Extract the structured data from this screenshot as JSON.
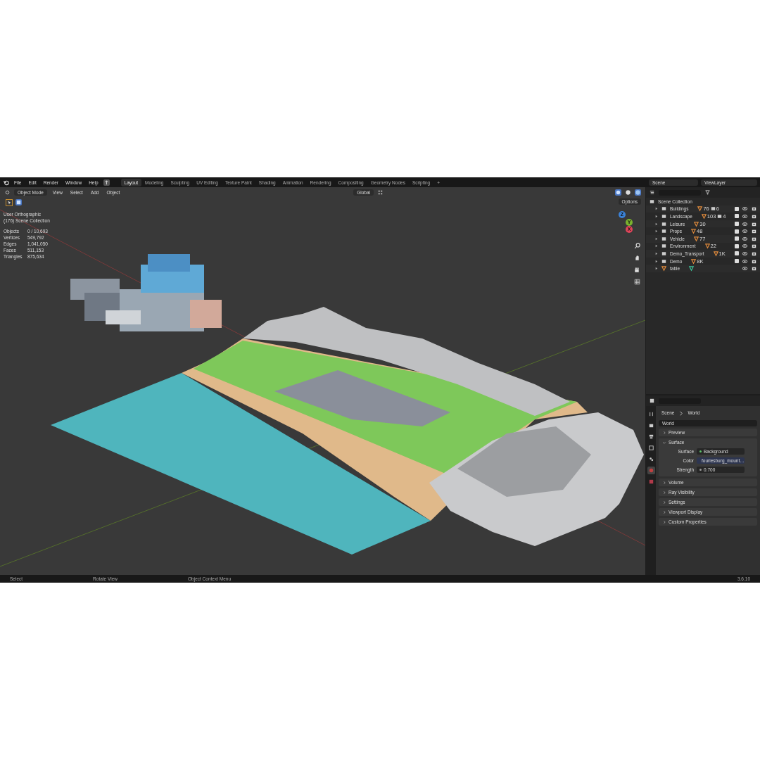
{
  "menu": [
    "File",
    "Edit",
    "Render",
    "Window",
    "Help"
  ],
  "workspaces": [
    {
      "label": "Layout",
      "selected": true
    },
    {
      "label": "Modeling",
      "selected": false
    },
    {
      "label": "Sculpting",
      "selected": false
    },
    {
      "label": "UV Editing",
      "selected": false
    },
    {
      "label": "Texture Paint",
      "selected": false
    },
    {
      "label": "Shading",
      "selected": false
    },
    {
      "label": "Animation",
      "selected": false
    },
    {
      "label": "Rendering",
      "selected": false
    },
    {
      "label": "Compositing",
      "selected": false
    },
    {
      "label": "Geometry Nodes",
      "selected": false
    },
    {
      "label": "Scripting",
      "selected": false
    }
  ],
  "add_tab": "+",
  "scene_field": "Scene",
  "view_layer_field": "ViewLayer",
  "viewport": {
    "mode": "Object Mode",
    "menus": [
      "View",
      "Select",
      "Add",
      "Object"
    ],
    "orientation": "Global",
    "options": "Options",
    "view_name": "User Orthographic",
    "collection": "(176) Scene Collection",
    "stats": [
      {
        "label": "Objects",
        "value": "0 / 10,693"
      },
      {
        "label": "Vertices",
        "value": "549,792"
      },
      {
        "label": "Edges",
        "value": "1,041,050"
      },
      {
        "label": "Faces",
        "value": "511,153"
      },
      {
        "label": "Triangles",
        "value": "875,634"
      }
    ],
    "gizmo": [
      "Z",
      "Y",
      "X"
    ]
  },
  "outliner": {
    "root": "Scene Collection",
    "items": [
      {
        "name": "Buildings",
        "kind": "collection",
        "checked": true,
        "counts": [
          "76",
          "6"
        ]
      },
      {
        "name": "Landscape",
        "kind": "collection",
        "checked": true,
        "counts": [
          "103",
          "4"
        ]
      },
      {
        "name": "Leisure",
        "kind": "collection",
        "checked": true,
        "counts": [
          "30"
        ]
      },
      {
        "name": "Props",
        "kind": "collection",
        "checked": true,
        "counts": [
          "48"
        ]
      },
      {
        "name": "Vehicle",
        "kind": "collection",
        "checked": true,
        "counts": [
          "77"
        ]
      },
      {
        "name": "Environment",
        "kind": "collection",
        "checked": true,
        "counts": [
          "22"
        ]
      },
      {
        "name": "Demo_Transport",
        "kind": "collection",
        "checked": true,
        "counts": [
          "1K"
        ]
      },
      {
        "name": "Demo",
        "kind": "collection",
        "checked": true,
        "counts": [
          "8K"
        ]
      },
      {
        "name": "table",
        "kind": "mesh"
      }
    ]
  },
  "properties": {
    "breadcrumb": [
      "Scene",
      "World"
    ],
    "world_field": "World",
    "panels": [
      {
        "label": "Preview",
        "expanded": false
      },
      {
        "label": "Surface",
        "expanded": true,
        "fields": [
          {
            "label": "Surface",
            "value": "Background",
            "kind": "shader"
          },
          {
            "label": "Color",
            "value": "fouriesburg_mount…",
            "kind": "texture"
          },
          {
            "label": "Strength",
            "value": "0.700",
            "kind": "number"
          }
        ]
      },
      {
        "label": "Volume",
        "expanded": false
      },
      {
        "label": "Ray Visibility",
        "expanded": false
      },
      {
        "label": "Settings",
        "expanded": false
      },
      {
        "label": "Viewport Display",
        "expanded": false
      },
      {
        "label": "Custom Properties",
        "expanded": false
      }
    ]
  },
  "status_bar": {
    "hints": [
      "Select",
      "Rotate View",
      "Object Context Menu"
    ],
    "version": "3.6.10"
  }
}
